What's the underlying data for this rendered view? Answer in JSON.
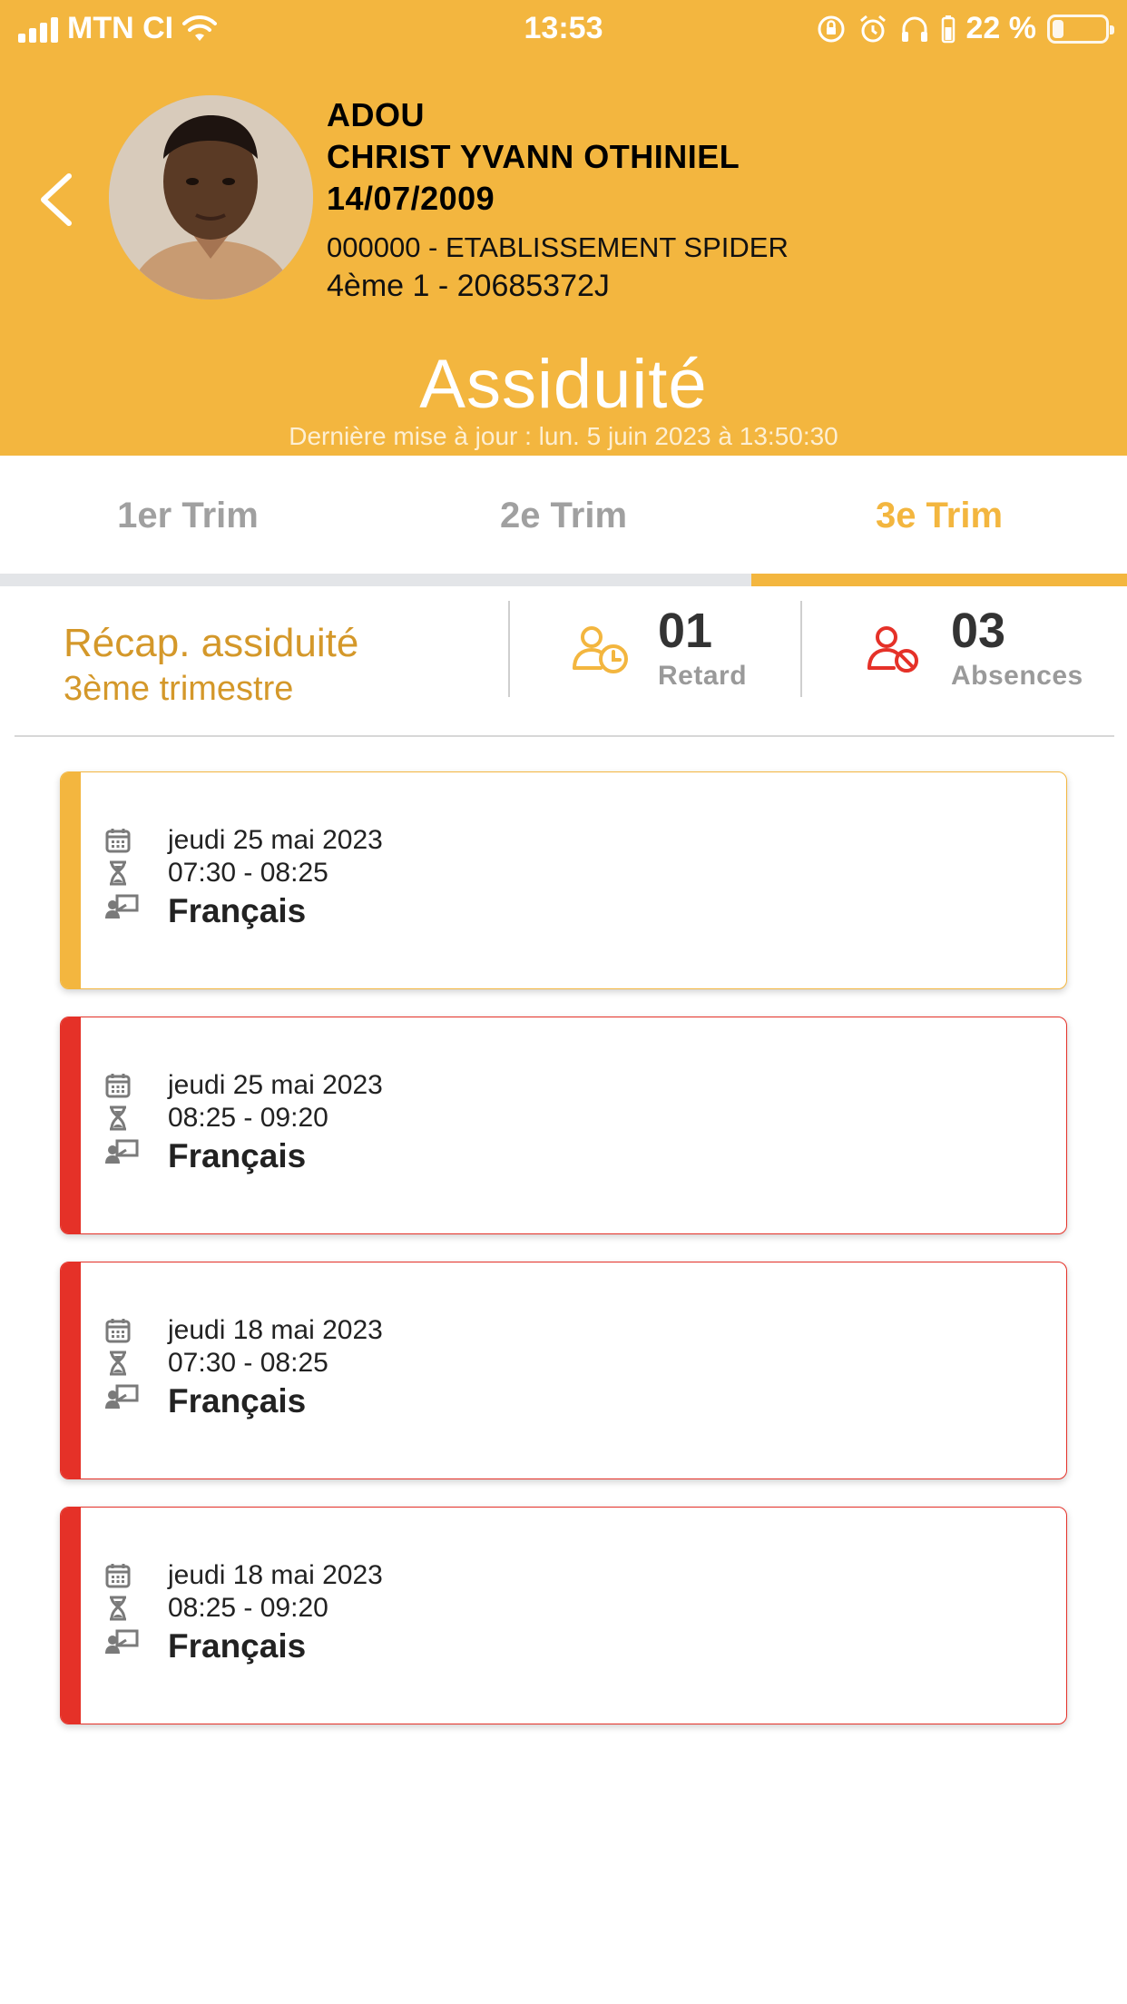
{
  "status_bar": {
    "carrier": "MTN CI",
    "time": "13:53",
    "battery_text": "22 %",
    "battery_level": 0.22
  },
  "student": {
    "last_name": "ADOU",
    "first_names": "CHRIST YVANN OTHINIEL",
    "birth_date": "14/07/2009",
    "school": "000000 - ETABLISSEMENT SPIDER",
    "class_line": "4ème 1 - 20685372J"
  },
  "page": {
    "title": "Assiduité",
    "last_update": "Dernière mise à jour : lun. 5 juin 2023 à 13:50:30"
  },
  "tabs": [
    {
      "label": "1er Trim",
      "active": false
    },
    {
      "label": "2e Trim",
      "active": false
    },
    {
      "label": "3e Trim",
      "active": true
    }
  ],
  "recap": {
    "title": "Récap. assiduité",
    "subtitle": "3ème trimestre",
    "late": {
      "value": "01",
      "label": "Retard"
    },
    "absences": {
      "value": "03",
      "label": "Absences"
    }
  },
  "colors": {
    "accent": "#F3B63F",
    "late": "#F3B63F",
    "absence": "#E53128"
  },
  "records": [
    {
      "type": "late",
      "date": "jeudi 25 mai 2023",
      "time": "07:30 - 08:25",
      "subject": "Français"
    },
    {
      "type": "absence",
      "date": "jeudi 25 mai 2023",
      "time": "08:25 - 09:20",
      "subject": "Français"
    },
    {
      "type": "absence",
      "date": "jeudi 18 mai 2023",
      "time": "07:30 - 08:25",
      "subject": "Français"
    },
    {
      "type": "absence",
      "date": "jeudi 18 mai 2023",
      "time": "08:25 - 09:20",
      "subject": "Français"
    }
  ]
}
